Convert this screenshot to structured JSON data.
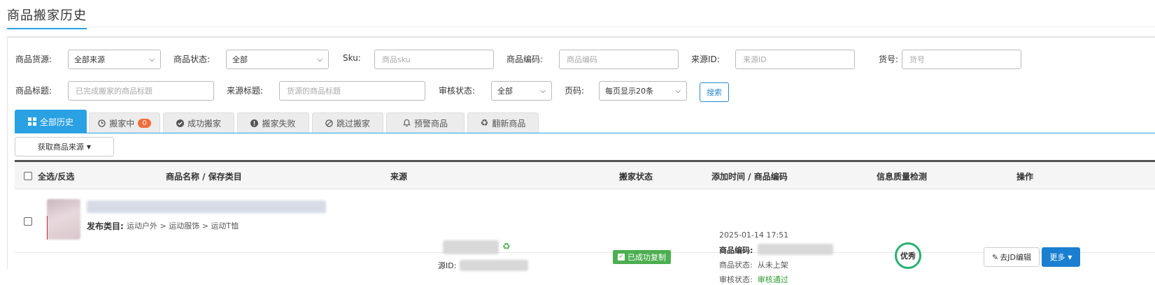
{
  "page": {
    "title": "商品搬家历史"
  },
  "filters": {
    "source_label": "商品货源:",
    "source_value": "全部来源",
    "status_label": "商品状态:",
    "status_value": "全部",
    "sku_label": "Sku:",
    "sku_placeholder": "商品sku",
    "code_label": "商品编码:",
    "code_placeholder": "商品编码",
    "source_id_label": "来源ID:",
    "source_id_placeholder": "来源ID",
    "item_no_label": "货号:",
    "item_no_placeholder": "货号",
    "title_label": "商品标题:",
    "title_placeholder": "已完成搬家的商品标题",
    "source_title_label": "来源标题:",
    "source_title_placeholder": "货源的商品标题",
    "review_label": "审核状态:",
    "review_value": "全部",
    "page_label": "页码:",
    "page_value": "每页显示20条",
    "search_button": "搜索"
  },
  "tabs": [
    {
      "label": "全部历史",
      "icon": "grid-icon",
      "active": true
    },
    {
      "label": "搬家中",
      "icon": "clock-icon",
      "badge": "0"
    },
    {
      "label": "成功搬家",
      "icon": "check-circle-icon"
    },
    {
      "label": "搬家失败",
      "icon": "exclamation-circle-icon"
    },
    {
      "label": "跳过搬家",
      "icon": "ban-icon"
    },
    {
      "label": "预警商品",
      "icon": "bell-icon"
    },
    {
      "label": "翻新商品",
      "icon": "recycle-icon"
    }
  ],
  "fetch_source_button": "获取商品来源",
  "table": {
    "headers": {
      "select_all": "全选/反选",
      "name": "商品名称 / 保存类目",
      "source": "来源",
      "status": "搬家状态",
      "time_code": "添加时间 / 商品编码",
      "quality": "信息质量检测",
      "actions": "操作"
    },
    "rows": [
      {
        "category_label": "发布类目:",
        "category_path": "运动户外 > 运动服饰 > 运动T恤",
        "source_id_label": "源ID:",
        "status": "已成功复制",
        "added_time": "2025-01-14 17:51",
        "code_label": "商品编码:",
        "goods_status_label": "商品状态:",
        "goods_status": "从未上架",
        "review_status_label": "审核状态:",
        "review_status": "审核通过",
        "quality": "优秀",
        "edit_button": "去JD编辑",
        "more_button": "更多"
      }
    ]
  },
  "colors": {
    "accent": "#2aa1e3",
    "success": "#4caf50",
    "primary_button": "#1a7fd0",
    "badge": "#f36b3b"
  }
}
